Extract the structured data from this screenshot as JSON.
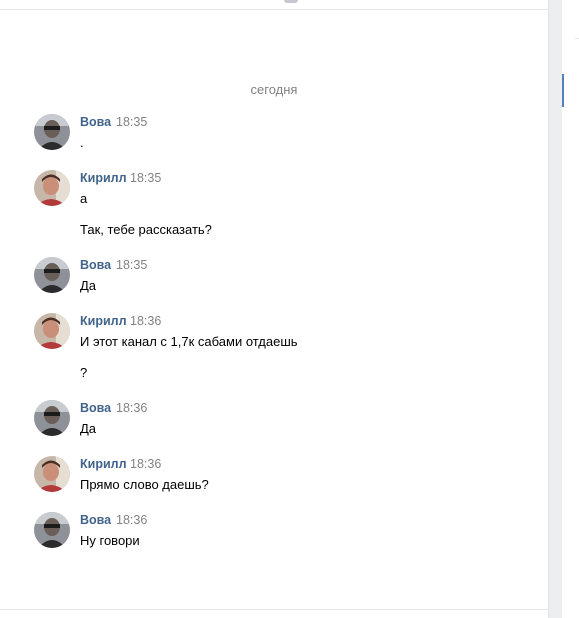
{
  "date_separator": "сегодня",
  "messages": [
    {
      "author": "Вова",
      "time": "18:35",
      "lines": [
        "."
      ]
    },
    {
      "author": "Кирилл",
      "time": "18:35",
      "lines": [
        "а",
        "Так, тебе рассказать?"
      ]
    },
    {
      "author": "Вова",
      "time": "18:35",
      "lines": [
        "Да"
      ]
    },
    {
      "author": "Кирилл",
      "time": "18:36",
      "lines": [
        "И этот канал с 1,7к сабами отдаешь",
        "?"
      ]
    },
    {
      "author": "Вова",
      "time": "18:36",
      "lines": [
        "Да"
      ]
    },
    {
      "author": "Кирилл",
      "time": "18:36",
      "lines": [
        "Прямо слово даешь?"
      ]
    },
    {
      "author": "Вова",
      "time": "18:36",
      "lines": [
        "Ну говори"
      ]
    }
  ],
  "colors": {
    "author_link": "#42648b",
    "meta_grey": "#828282",
    "accent": "#5181b8"
  }
}
